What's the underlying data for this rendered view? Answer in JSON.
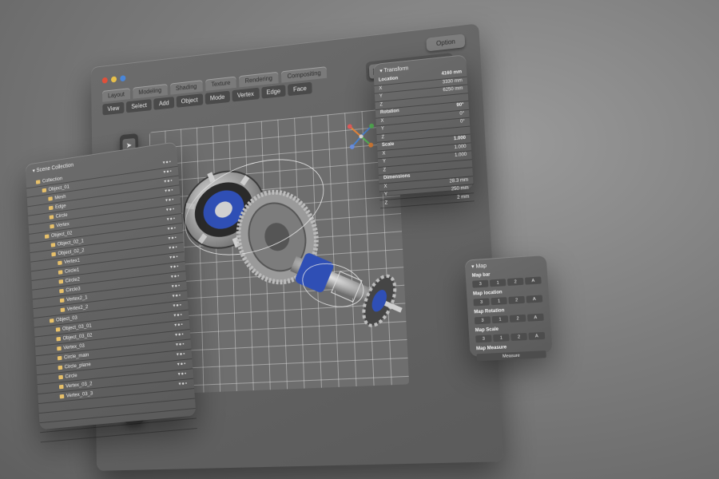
{
  "colors": {
    "dot_close": "#e0503a",
    "dot_min": "#e8c04a",
    "dot_max": "#4a86d8",
    "gear_blue": "#2f4fb5",
    "gizmo_orange": "#e8873a"
  },
  "main": {
    "option_label": "Option",
    "tabs": [
      "Layout",
      "Modeling",
      "Shading",
      "Texture",
      "Rendering",
      "Compositing"
    ],
    "menus": [
      "View",
      "Select",
      "Add",
      "Object",
      "Mode",
      "Vertex",
      "Edge",
      "Face"
    ],
    "icon_buttons": [
      "cube-icon",
      "orbit-icon",
      "pan-icon",
      "refresh-icon",
      "zoom-icon"
    ],
    "tools": [
      "cursor-icon",
      "zoom-icon",
      "move-icon",
      "rotate-icon",
      "scale-icon",
      "transform-icon",
      "measure-icon",
      "brush-icon",
      "knife-icon",
      "spin-icon",
      "loop-icon",
      "add-icon"
    ]
  },
  "outliner": {
    "title": "Scene Collection",
    "rows": [
      {
        "label": "Collection",
        "indent": 1
      },
      {
        "label": "Object_01",
        "indent": 2
      },
      {
        "label": "Mesh",
        "indent": 3
      },
      {
        "label": "Edge",
        "indent": 3
      },
      {
        "label": "Circle",
        "indent": 3
      },
      {
        "label": "Vertex",
        "indent": 3
      },
      {
        "label": "Object_02",
        "indent": 2
      },
      {
        "label": "Object_02_1",
        "indent": 3
      },
      {
        "label": "Object_02_2",
        "indent": 3
      },
      {
        "label": "Vertex1",
        "indent": 4
      },
      {
        "label": "Circle1",
        "indent": 4
      },
      {
        "label": "Circle2",
        "indent": 4
      },
      {
        "label": "Circle3",
        "indent": 4
      },
      {
        "label": "Vertex2_1",
        "indent": 4
      },
      {
        "label": "Vertex2_2",
        "indent": 4
      },
      {
        "label": "Object_03",
        "indent": 2
      },
      {
        "label": "Object_03_01",
        "indent": 3
      },
      {
        "label": "Object_03_02",
        "indent": 3
      },
      {
        "label": "Vertex_03",
        "indent": 3
      },
      {
        "label": "Circle_main",
        "indent": 3
      },
      {
        "label": "Circle_plane",
        "indent": 3
      },
      {
        "label": "Circle",
        "indent": 3
      },
      {
        "label": "Vertex_03_2",
        "indent": 3
      },
      {
        "label": "Vertex_03_3",
        "indent": 3
      }
    ]
  },
  "transform": {
    "title": "Transform",
    "rows": [
      {
        "k": "Location",
        "v": "4160 mm",
        "sec": true
      },
      {
        "k": "X",
        "v": "3330 mm"
      },
      {
        "k": "Y",
        "v": "6250 mm"
      },
      {
        "k": "Z",
        "v": ""
      },
      {
        "k": "Rotation",
        "v": "90°",
        "sec": true
      },
      {
        "k": "X",
        "v": "0°"
      },
      {
        "k": "Y",
        "v": "0°"
      },
      {
        "k": "Z",
        "v": ""
      },
      {
        "k": "Scale",
        "v": "1.000",
        "sec": true
      },
      {
        "k": "X",
        "v": "1.000"
      },
      {
        "k": "Y",
        "v": "1.000"
      },
      {
        "k": "Z",
        "v": ""
      },
      {
        "k": "Dimensions",
        "v": "",
        "sec": true
      },
      {
        "k": "X",
        "v": "28.3 mm"
      },
      {
        "k": "Y",
        "v": "250 mm"
      },
      {
        "k": "Z",
        "v": "2 mm"
      }
    ]
  },
  "mappanel": {
    "title": "Map",
    "sections": [
      {
        "label": "Map bar",
        "buttons": [
          "3",
          "1",
          "2",
          "A"
        ]
      },
      {
        "label": "Map location",
        "buttons": [
          "3",
          "1",
          "2",
          "A"
        ]
      },
      {
        "label": "Map Rotation",
        "buttons": [
          "3",
          "1",
          "2",
          "A"
        ]
      },
      {
        "label": "Map Scale",
        "buttons": [
          "3",
          "1",
          "2",
          "A"
        ]
      },
      {
        "label": "Map Measure",
        "buttons": [
          "Measure"
        ]
      }
    ]
  }
}
